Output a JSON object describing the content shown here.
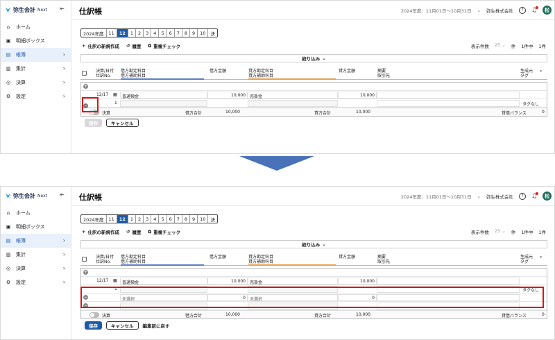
{
  "app": {
    "name": "弥生会計",
    "name_suffix": "Next"
  },
  "sidebar": {
    "items": [
      {
        "label": "ホーム",
        "icon": "home-icon"
      },
      {
        "label": "明細ボックス",
        "icon": "box-icon"
      },
      {
        "label": "帳簿",
        "icon": "book-icon",
        "active": true
      },
      {
        "label": "集計",
        "icon": "chart-icon"
      },
      {
        "label": "決算",
        "icon": "settlement-icon"
      },
      {
        "label": "設定",
        "icon": "gear-icon"
      }
    ]
  },
  "header": {
    "title": "仕訳帳",
    "period": "2024年度：11月01日〜10月31日",
    "company": "弥生株式会社",
    "help": "?",
    "avatar": "松"
  },
  "months": [
    "2024年度",
    "11",
    "12",
    "1",
    "2",
    "3",
    "4",
    "5",
    "6",
    "7",
    "8",
    "9",
    "10",
    "決"
  ],
  "selected_month": "12",
  "toolbar": {
    "new_entry": "仕訳の新規作成",
    "history": "履歴",
    "duplicate_check": "重複チェック",
    "display_count_label": "表示件数",
    "display_count": "25",
    "unit": "件",
    "range": "1件中",
    "count": "1件"
  },
  "filter": {
    "label": "絞り込み"
  },
  "columns": {
    "date": "決算/日付",
    "entry_no": "仕訳No.",
    "debit_account": "借方勘定科目",
    "debit_sub": "借方補助科目",
    "debit_amount": "借方金額",
    "credit_account": "貸方勘定科目",
    "credit_sub": "貸方補助科目",
    "credit_amount": "貸方金額",
    "memo": "摘要",
    "partner": "取引先",
    "source": "生成元",
    "tag": "タグ"
  },
  "entry": {
    "date": "12/17",
    "no": "1",
    "debit_account": "普通預金",
    "debit_amount": "10,000",
    "credit_account": "売掛金",
    "credit_amount": "10,000",
    "tag": "タグなし"
  },
  "new_row": {
    "debit_account": "未選択",
    "debit_amount": "0",
    "credit_account": "未選択",
    "credit_amount": "0"
  },
  "summary": {
    "settlement": "決算",
    "debit_total_label": "借方合計",
    "debit_total": "10,000",
    "credit_total_label": "貸方合計",
    "credit_total": "10,000",
    "balance_label": "貸借バランス",
    "balance": "0"
  },
  "buttons": {
    "save": "保存",
    "cancel": "キャンセル",
    "restore": "編集前に戻す"
  },
  "colors": {
    "accent": "#1e5aa8",
    "highlight": "#d71618",
    "arrow": "#4a72b8"
  }
}
